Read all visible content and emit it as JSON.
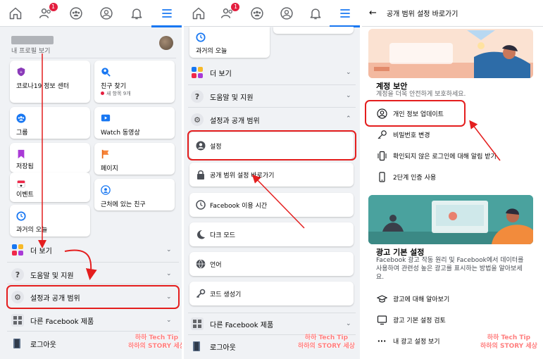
{
  "panel1": {
    "profile_sub": "내 프로필 보기",
    "shortcuts": [
      {
        "label": "코로나19 정보 센터",
        "icon": "shield-icon"
      },
      {
        "label": "친구 찾기",
        "sub": "새 항목 9개",
        "icon": "friends-search-icon"
      },
      {
        "label": "그룹",
        "icon": "groups-icon"
      },
      {
        "label": "Watch 동영상",
        "icon": "watch-icon"
      },
      {
        "label": "저장됨",
        "icon": "bookmark-icon"
      },
      {
        "label": "페이지",
        "icon": "flag-icon"
      },
      {
        "label": "이벤트",
        "icon": "calendar-icon"
      },
      {
        "label": "근처에 있는 친구",
        "icon": "nearby-icon"
      },
      {
        "label": "과거의 오늘",
        "icon": "memories-icon"
      }
    ],
    "rows": [
      {
        "label": "더 보기",
        "icon": "more-icon"
      },
      {
        "label": "도움말 및 지원",
        "icon": "help-icon"
      },
      {
        "label": "설정과 공개 범위",
        "icon": "gear-icon"
      },
      {
        "label": "다른 Facebook 제품",
        "icon": "grid-icon"
      },
      {
        "label": "로그아웃",
        "icon": "logout-icon"
      }
    ]
  },
  "panel2": {
    "top_card_label": "과거의 오늘",
    "rows": [
      {
        "label": "더 보기",
        "icon": "more-icon"
      },
      {
        "label": "도움말 및 지원",
        "icon": "help-icon"
      },
      {
        "label": "설정과 공개 범위",
        "icon": "gear-icon"
      }
    ],
    "settings_items": [
      {
        "label": "설정",
        "icon": "user-circle-icon"
      },
      {
        "label": "공개 범위 설정 바로가기",
        "icon": "lock-icon"
      },
      {
        "label": "Facebook 이용 시간",
        "icon": "clock-icon"
      },
      {
        "label": "다크 모드",
        "icon": "moon-icon"
      },
      {
        "label": "언어",
        "icon": "globe-icon"
      },
      {
        "label": "코드 생성기",
        "icon": "key-icon"
      }
    ],
    "bottom_rows": [
      {
        "label": "다른 Facebook 제품",
        "icon": "grid-icon"
      },
      {
        "label": "로그아웃",
        "icon": "logout-icon"
      }
    ]
  },
  "panel3": {
    "header_title": "공개 범위 설정 바로가기",
    "security": {
      "title": "계정 보안",
      "desc": "계정을 더욱 안전하게 보호하세요.",
      "options": [
        {
          "label": "개인 정보 업데이트",
          "icon": "person-circle-icon"
        },
        {
          "label": "비밀번호 변경",
          "icon": "key-icon"
        },
        {
          "label": "확인되지 않은 로그인에 대해 알림 받기",
          "icon": "phone-vibrate-icon"
        },
        {
          "label": "2단계 인증 사용",
          "icon": "phone-icon"
        }
      ]
    },
    "ads": {
      "title": "광고 기본 설정",
      "desc": "Facebook 광고 작동 원리 및 Facebook에서 데이터를 사용하여 관련성 높은 광고를 표시하는 방법을 알아보세요.",
      "options": [
        {
          "label": "광고에 대해 알아보기",
          "icon": "grad-cap-icon"
        },
        {
          "label": "광고 기본 설정 검토",
          "icon": "screen-icon"
        },
        {
          "label": "내 광고 설정 보기",
          "icon": "ellipsis-icon"
        }
      ]
    }
  },
  "watermark": {
    "line1": "하하 Tech Tip",
    "line2": "하하의 STORY 세상"
  },
  "colors": {
    "accent": "#1877f2",
    "highlight": "#e41e1e",
    "background": "#f0f2f5"
  }
}
